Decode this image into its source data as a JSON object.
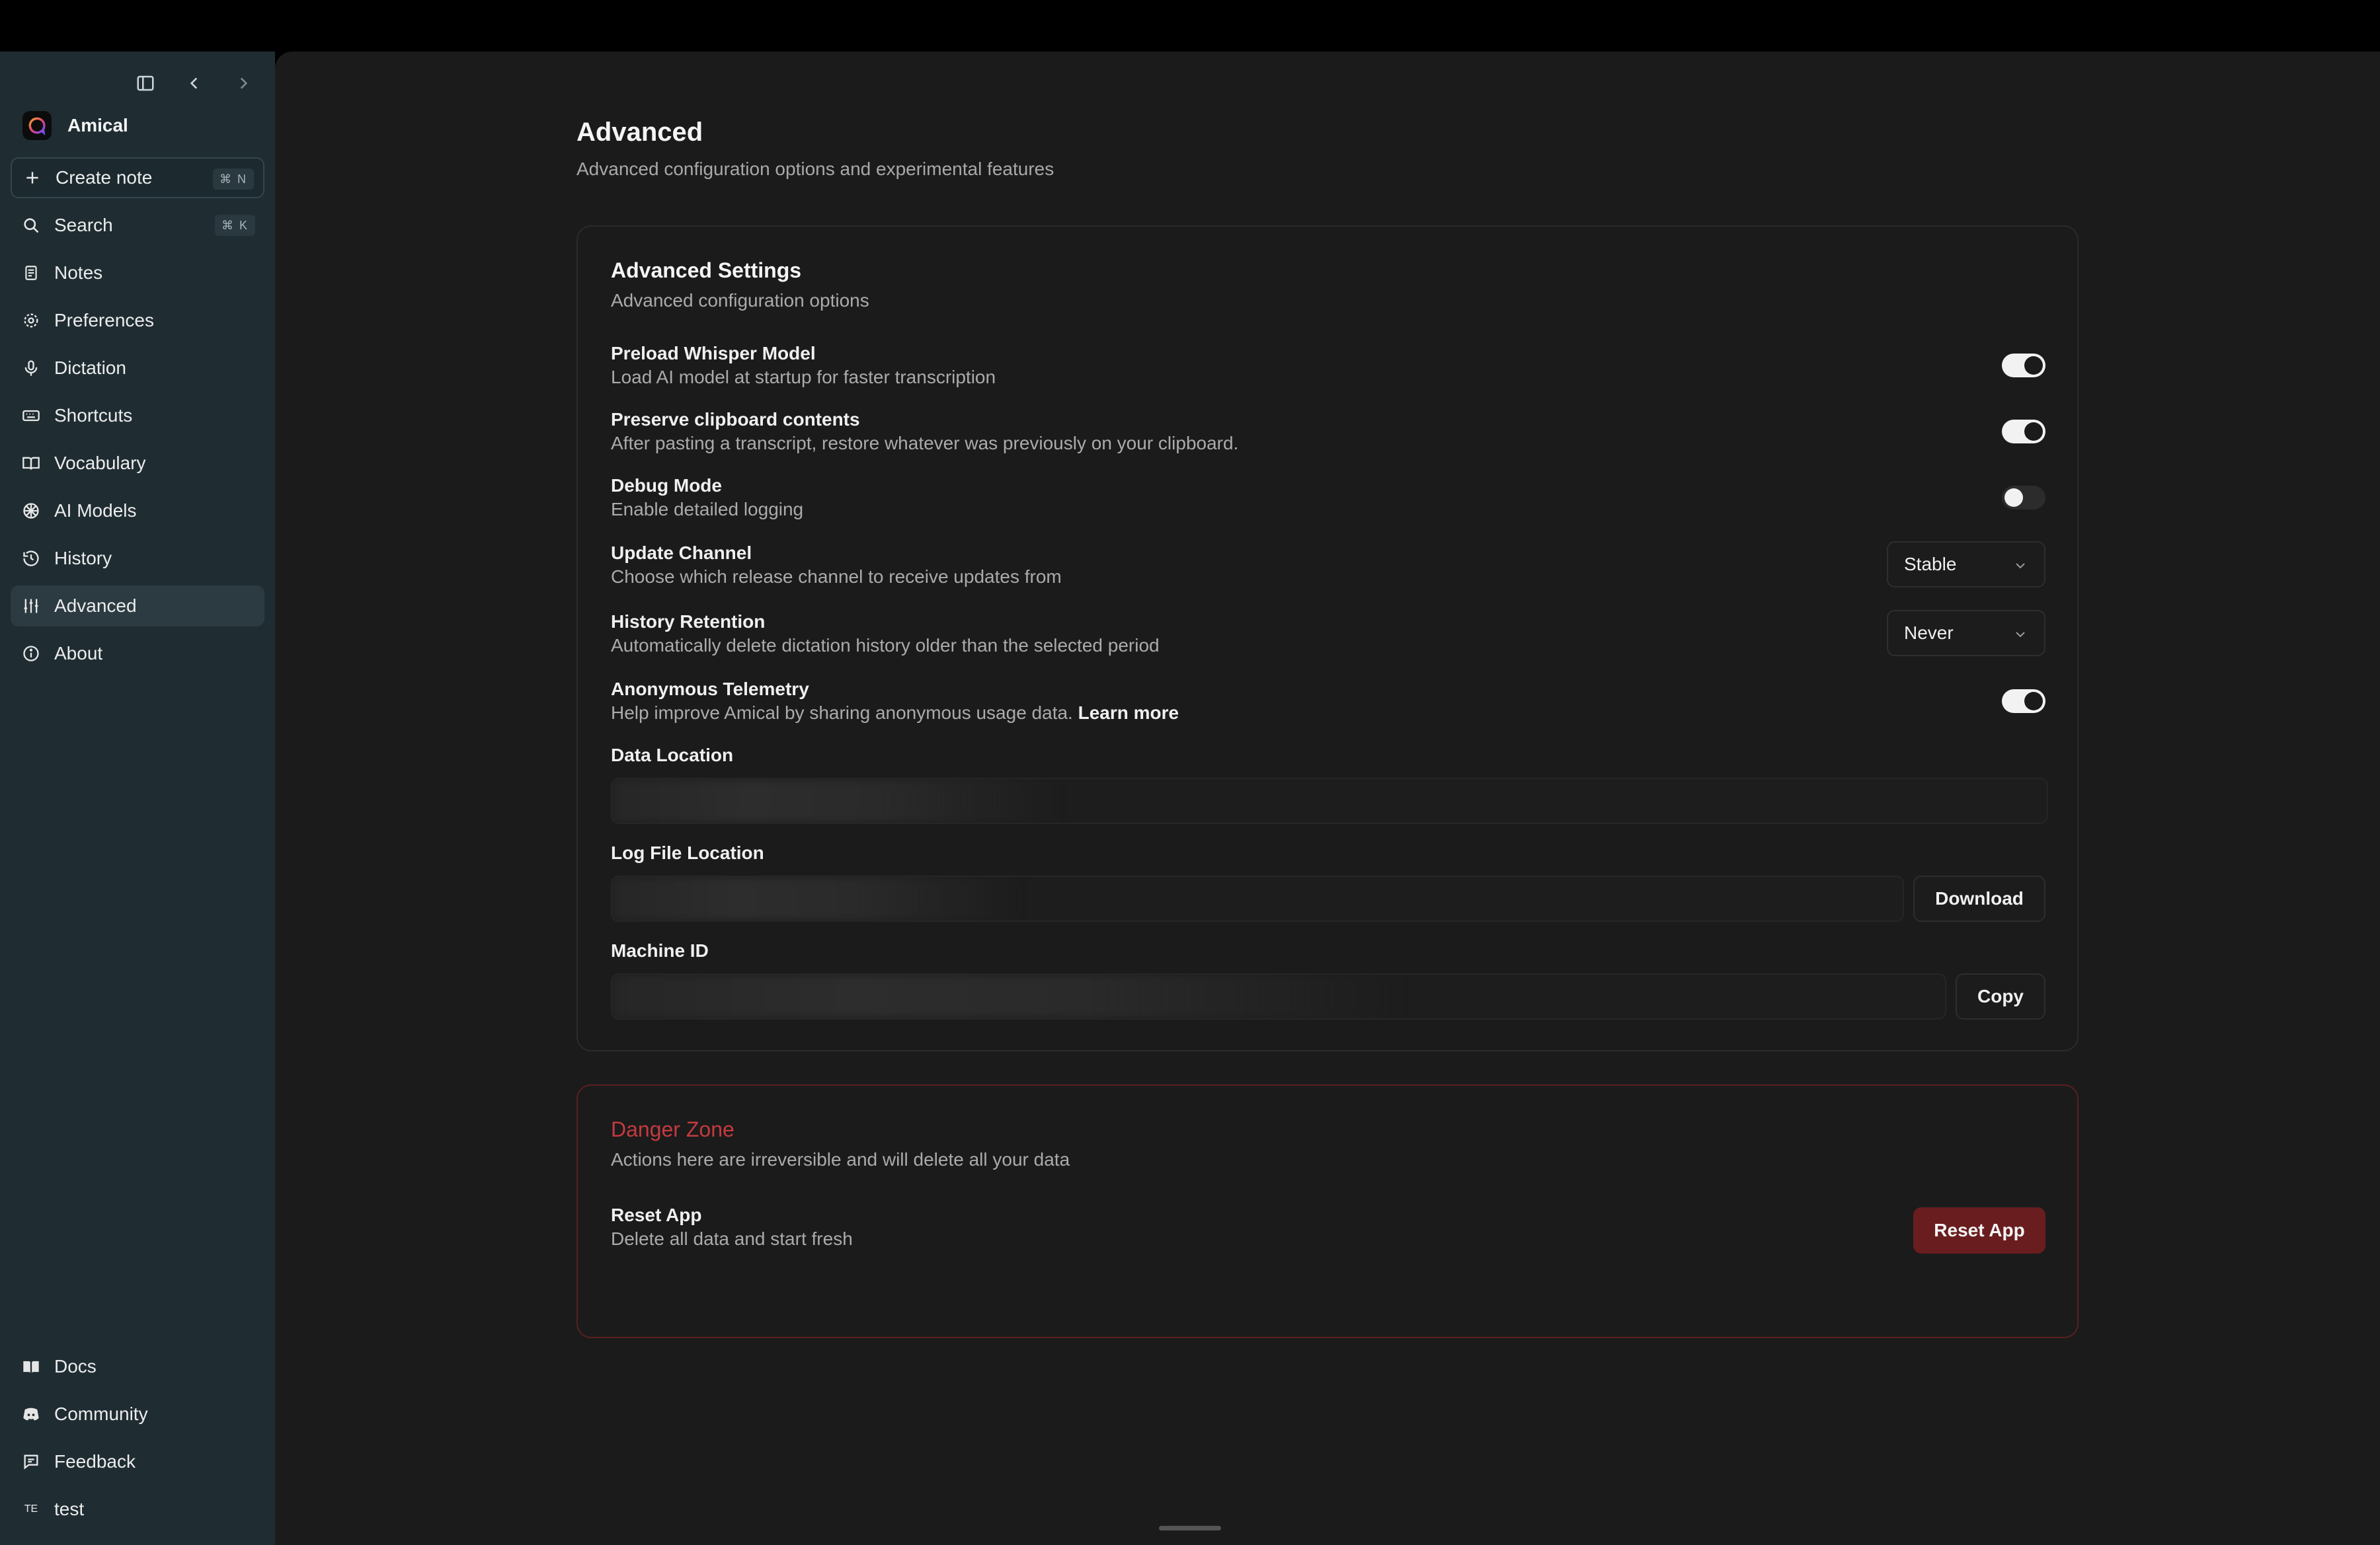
{
  "app": {
    "name": "Amical"
  },
  "sidebar": {
    "create_note": {
      "label": "Create note",
      "shortcut": "⌘ N"
    },
    "search": {
      "label": "Search",
      "shortcut": "⌘ K"
    },
    "items": [
      {
        "label": "Notes",
        "icon": "notes-icon"
      },
      {
        "label": "Preferences",
        "icon": "gear-icon"
      },
      {
        "label": "Dictation",
        "icon": "microphone-icon"
      },
      {
        "label": "Shortcuts",
        "icon": "keyboard-icon"
      },
      {
        "label": "Vocabulary",
        "icon": "book-icon"
      },
      {
        "label": "AI Models",
        "icon": "ai-model-icon"
      },
      {
        "label": "History",
        "icon": "history-icon"
      },
      {
        "label": "Advanced",
        "icon": "sliders-icon",
        "active": true
      },
      {
        "label": "About",
        "icon": "info-icon"
      }
    ],
    "bottom": [
      {
        "label": "Docs",
        "icon": "docs-icon"
      },
      {
        "label": "Community",
        "icon": "discord-icon"
      },
      {
        "label": "Feedback",
        "icon": "feedback-icon"
      },
      {
        "label": "test",
        "icon_text": "TE"
      }
    ]
  },
  "page": {
    "title": "Advanced",
    "subtitle": "Advanced configuration options and experimental features"
  },
  "advanced": {
    "title": "Advanced Settings",
    "subtitle": "Advanced configuration options",
    "preload": {
      "label": "Preload Whisper Model",
      "desc": "Load AI model at startup for faster transcription",
      "enabled": true
    },
    "clipboard": {
      "label": "Preserve clipboard contents",
      "desc": "After pasting a transcript, restore whatever was previously on your clipboard.",
      "enabled": true
    },
    "debug": {
      "label": "Debug Mode",
      "desc": "Enable detailed logging",
      "enabled": false
    },
    "update_channel": {
      "label": "Update Channel",
      "desc": "Choose which release channel to receive updates from",
      "value": "Stable"
    },
    "history_retention": {
      "label": "History Retention",
      "desc": "Automatically delete dictation history older than the selected period",
      "value": "Never"
    },
    "telemetry": {
      "label": "Anonymous Telemetry",
      "desc": "Help improve Amical by sharing anonymous usage data.",
      "link": "Learn more",
      "enabled": true
    },
    "data_location": {
      "label": "Data Location"
    },
    "log_location": {
      "label": "Log File Location",
      "button": "Download"
    },
    "machine_id": {
      "label": "Machine ID",
      "button": "Copy"
    }
  },
  "danger": {
    "title": "Danger Zone",
    "subtitle": "Actions here are irreversible and will delete all your data",
    "reset": {
      "label": "Reset App",
      "desc": "Delete all data and start fresh",
      "button": "Reset App"
    }
  },
  "colors": {
    "sidebar_bg": "#1f2d33",
    "main_bg": "#1b1b1b",
    "danger": "#c43a3f",
    "danger_button": "#6a1d1f"
  }
}
